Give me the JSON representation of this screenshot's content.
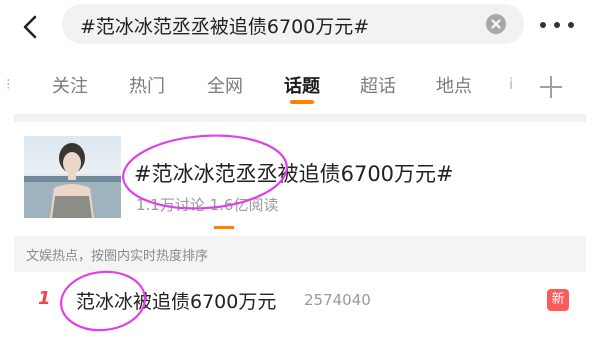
{
  "search": {
    "query": "#范冰冰范丞丞被追债6700万元#"
  },
  "tabs": {
    "items": [
      {
        "label": "关注"
      },
      {
        "label": "热门"
      },
      {
        "label": "全网"
      },
      {
        "label": "话题"
      },
      {
        "label": "超话"
      },
      {
        "label": "地点"
      }
    ],
    "active_index": 3,
    "left_partial": "⁝",
    "right_partial": "i"
  },
  "topic": {
    "title": "#范冰冰范丞丞被追债6700万元#",
    "stats": "1.1万讨论 1.6亿阅读"
  },
  "hot_section": {
    "header": "文娱热点，按圈内实时热度排序",
    "items": [
      {
        "rank": "1",
        "title": "范冰冰被追债6700万元",
        "count": "2574040",
        "badge": "新"
      }
    ]
  },
  "colors": {
    "accent": "#ff8200",
    "rank_red": "#f5424a",
    "badge_red": "#ff5a5a",
    "annotation_circle": "#e040e8"
  },
  "icons": [
    "back-arrow-icon",
    "clear-icon",
    "more-icon",
    "plus-icon"
  ]
}
